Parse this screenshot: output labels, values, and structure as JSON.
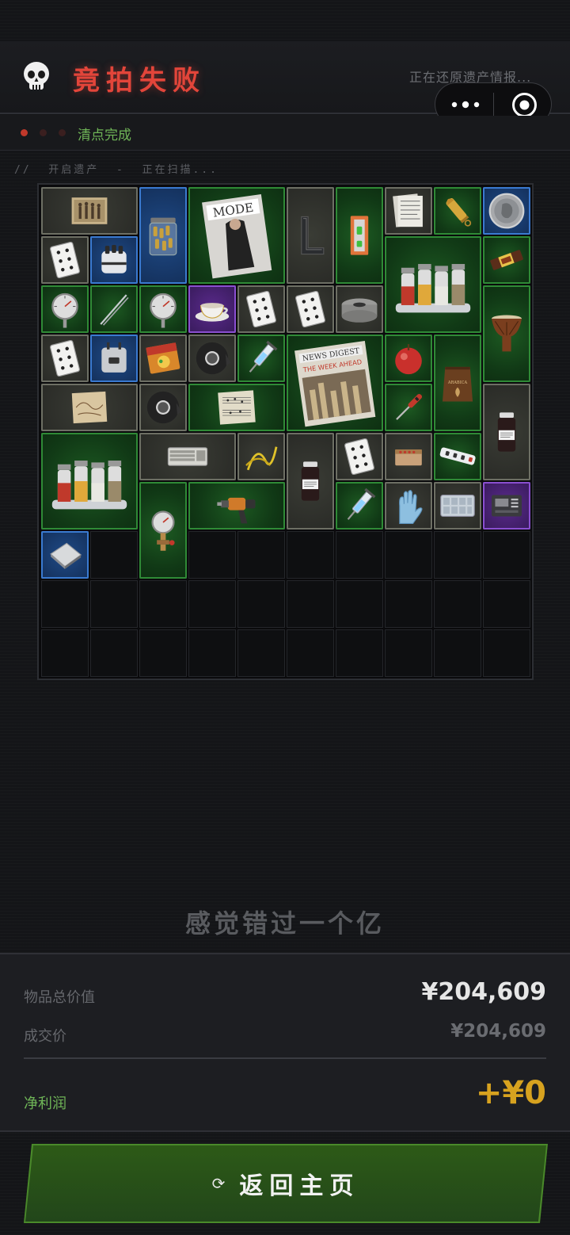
{
  "header": {
    "title": "竟拍失败",
    "restore_text": "正在还原遗产情报...",
    "skull_icon": "skull-icon",
    "accent": "#e2453a"
  },
  "mini_program": {
    "more_icon": "more-dots-icon",
    "close_icon": "target-close-icon"
  },
  "status": {
    "text": "清点完成",
    "dots": [
      "#c0392b",
      "#3a1f1f",
      "#3a1f1f"
    ],
    "scan_text": "//  开启遗产  -  正在扫描..."
  },
  "grid": {
    "columns": 10,
    "rows": 10,
    "items": [
      {
        "name": "old-photo-item",
        "icon": "photo",
        "rarity": "gray",
        "c": 0,
        "r": 0,
        "w": 2,
        "h": 1
      },
      {
        "name": "bullet-jar-item",
        "icon": "jar",
        "rarity": "blue",
        "c": 2,
        "r": 0,
        "w": 1,
        "h": 2
      },
      {
        "name": "fashion-magazine-item",
        "icon": "magazine",
        "rarity": "green",
        "c": 3,
        "r": 0,
        "w": 2,
        "h": 2
      },
      {
        "name": "metal-bracket-item",
        "icon": "bracket",
        "rarity": "gray",
        "c": 5,
        "r": 0,
        "w": 1,
        "h": 2
      },
      {
        "name": "level-tool-item",
        "icon": "level",
        "rarity": "green",
        "c": 6,
        "r": 0,
        "w": 1,
        "h": 2
      },
      {
        "name": "documents-item",
        "icon": "papers",
        "rarity": "gray",
        "c": 7,
        "r": 0,
        "w": 1,
        "h": 1
      },
      {
        "name": "brass-cartridge-item",
        "icon": "cartridge",
        "rarity": "green",
        "c": 8,
        "r": 0,
        "w": 1,
        "h": 1
      },
      {
        "name": "silver-coin-item",
        "icon": "coin",
        "rarity": "blue",
        "c": 9,
        "r": 0,
        "w": 1,
        "h": 1
      },
      {
        "name": "playing-card-item",
        "icon": "card",
        "rarity": "gray",
        "c": 0,
        "r": 1,
        "w": 1,
        "h": 1
      },
      {
        "name": "medicine-box-item",
        "icon": "pills",
        "rarity": "blue",
        "c": 1,
        "r": 1,
        "w": 1,
        "h": 1
      },
      {
        "name": "spice-rack-item",
        "icon": "spice",
        "rarity": "green",
        "c": 7,
        "r": 1,
        "w": 2,
        "h": 2
      },
      {
        "name": "chocolate-bar-item",
        "icon": "chocolate",
        "rarity": "green",
        "c": 9,
        "r": 1,
        "w": 1,
        "h": 1
      },
      {
        "name": "thermometer-item",
        "icon": "gauge",
        "rarity": "green",
        "c": 0,
        "r": 2,
        "w": 1,
        "h": 1
      },
      {
        "name": "tweezers-item",
        "icon": "tweezers",
        "rarity": "green",
        "c": 1,
        "r": 2,
        "w": 1,
        "h": 1
      },
      {
        "name": "thermometer-item",
        "icon": "gauge",
        "rarity": "green",
        "c": 2,
        "r": 2,
        "w": 1,
        "h": 1
      },
      {
        "name": "teacup-item",
        "icon": "teacup",
        "rarity": "purple",
        "c": 3,
        "r": 2,
        "w": 1,
        "h": 1
      },
      {
        "name": "playing-card-item",
        "icon": "card",
        "rarity": "gray",
        "c": 4,
        "r": 2,
        "w": 1,
        "h": 1
      },
      {
        "name": "playing-card-item",
        "icon": "card",
        "rarity": "gray",
        "c": 5,
        "r": 2,
        "w": 1,
        "h": 1
      },
      {
        "name": "tape-roll-item",
        "icon": "tape",
        "rarity": "gray",
        "c": 6,
        "r": 2,
        "w": 1,
        "h": 1
      },
      {
        "name": "drum-item",
        "icon": "drum",
        "rarity": "green",
        "c": 9,
        "r": 2,
        "w": 1,
        "h": 2
      },
      {
        "name": "playing-card-item",
        "icon": "card",
        "rarity": "gray",
        "c": 0,
        "r": 3,
        "w": 1,
        "h": 1
      },
      {
        "name": "power-adapter-item",
        "icon": "adapter",
        "rarity": "blue",
        "c": 1,
        "r": 3,
        "w": 1,
        "h": 1
      },
      {
        "name": "snack-pack-item",
        "icon": "snack",
        "rarity": "gray",
        "c": 2,
        "r": 3,
        "w": 1,
        "h": 1
      },
      {
        "name": "duct-tape-item",
        "icon": "ducttape",
        "rarity": "gray",
        "c": 3,
        "r": 3,
        "w": 1,
        "h": 1
      },
      {
        "name": "syringe-item",
        "icon": "syringe",
        "rarity": "green",
        "c": 4,
        "r": 3,
        "w": 1,
        "h": 1
      },
      {
        "name": "newspaper-item",
        "icon": "newspaper",
        "rarity": "green",
        "c": 5,
        "r": 3,
        "w": 2,
        "h": 2
      },
      {
        "name": "apple-item",
        "icon": "apple",
        "rarity": "green",
        "c": 7,
        "r": 3,
        "w": 1,
        "h": 1
      },
      {
        "name": "coffee-bag-item",
        "icon": "coffee",
        "rarity": "green",
        "c": 8,
        "r": 3,
        "w": 1,
        "h": 2
      },
      {
        "name": "old-map-item",
        "icon": "map",
        "rarity": "gray",
        "c": 0,
        "r": 4,
        "w": 2,
        "h": 1
      },
      {
        "name": "duct-tape-item",
        "icon": "ducttape",
        "rarity": "gray",
        "c": 2,
        "r": 4,
        "w": 1,
        "h": 1
      },
      {
        "name": "sheet-music-item",
        "icon": "sheet",
        "rarity": "green",
        "c": 3,
        "r": 4,
        "w": 2,
        "h": 1
      },
      {
        "name": "screwdriver-item",
        "icon": "screwdriver",
        "rarity": "green",
        "c": 7,
        "r": 4,
        "w": 1,
        "h": 1
      },
      {
        "name": "sample-vial-item",
        "icon": "vial",
        "rarity": "gray",
        "c": 9,
        "r": 4,
        "w": 1,
        "h": 2
      },
      {
        "name": "spice-rack-item",
        "icon": "spice",
        "rarity": "green",
        "c": 0,
        "r": 5,
        "w": 2,
        "h": 2
      },
      {
        "name": "keyboard-item",
        "icon": "keyboard",
        "rarity": "gray",
        "c": 2,
        "r": 5,
        "w": 2,
        "h": 1
      },
      {
        "name": "cable-bundle-item",
        "icon": "cable",
        "rarity": "gray",
        "c": 4,
        "r": 5,
        "w": 1,
        "h": 1
      },
      {
        "name": "sample-vial-item",
        "icon": "vial",
        "rarity": "gray",
        "c": 5,
        "r": 5,
        "w": 1,
        "h": 2
      },
      {
        "name": "playing-card-item",
        "icon": "card",
        "rarity": "gray",
        "c": 6,
        "r": 5,
        "w": 1,
        "h": 1
      },
      {
        "name": "matchbox-item",
        "icon": "matches",
        "rarity": "gray",
        "c": 7,
        "r": 5,
        "w": 1,
        "h": 1
      },
      {
        "name": "power-strip-item",
        "icon": "powerstrip",
        "rarity": "green",
        "c": 8,
        "r": 5,
        "w": 1,
        "h": 1
      },
      {
        "name": "pressure-gauge-item",
        "icon": "pressure",
        "rarity": "green",
        "c": 2,
        "r": 6,
        "w": 1,
        "h": 2
      },
      {
        "name": "power-drill-item",
        "icon": "drill",
        "rarity": "green",
        "c": 3,
        "r": 6,
        "w": 2,
        "h": 1
      },
      {
        "name": "syringe-item",
        "icon": "syringe",
        "rarity": "green",
        "c": 6,
        "r": 6,
        "w": 1,
        "h": 1
      },
      {
        "name": "rubber-gloves-item",
        "icon": "gloves",
        "rarity": "gray",
        "c": 7,
        "r": 6,
        "w": 1,
        "h": 1
      },
      {
        "name": "pill-tray-item",
        "icon": "tray",
        "rarity": "gray",
        "c": 8,
        "r": 6,
        "w": 1,
        "h": 1
      },
      {
        "name": "circuit-device-item",
        "icon": "device",
        "rarity": "purple",
        "c": 9,
        "r": 6,
        "w": 1,
        "h": 1
      },
      {
        "name": "silver-plate-item",
        "icon": "plate",
        "rarity": "blue",
        "c": 0,
        "r": 7,
        "w": 1,
        "h": 1
      }
    ]
  },
  "result": {
    "missed_text": "感觉错过一个亿",
    "total_value_label": "物品总价值",
    "total_value": "¥204,609",
    "deal_price_label": "成交价",
    "deal_price": "¥204,609",
    "net_profit_label": "净利润",
    "net_profit": "+¥0",
    "profit_color": "#d7a21f"
  },
  "footer": {
    "return_label": "返回主页",
    "return_icon": "refresh-icon"
  }
}
